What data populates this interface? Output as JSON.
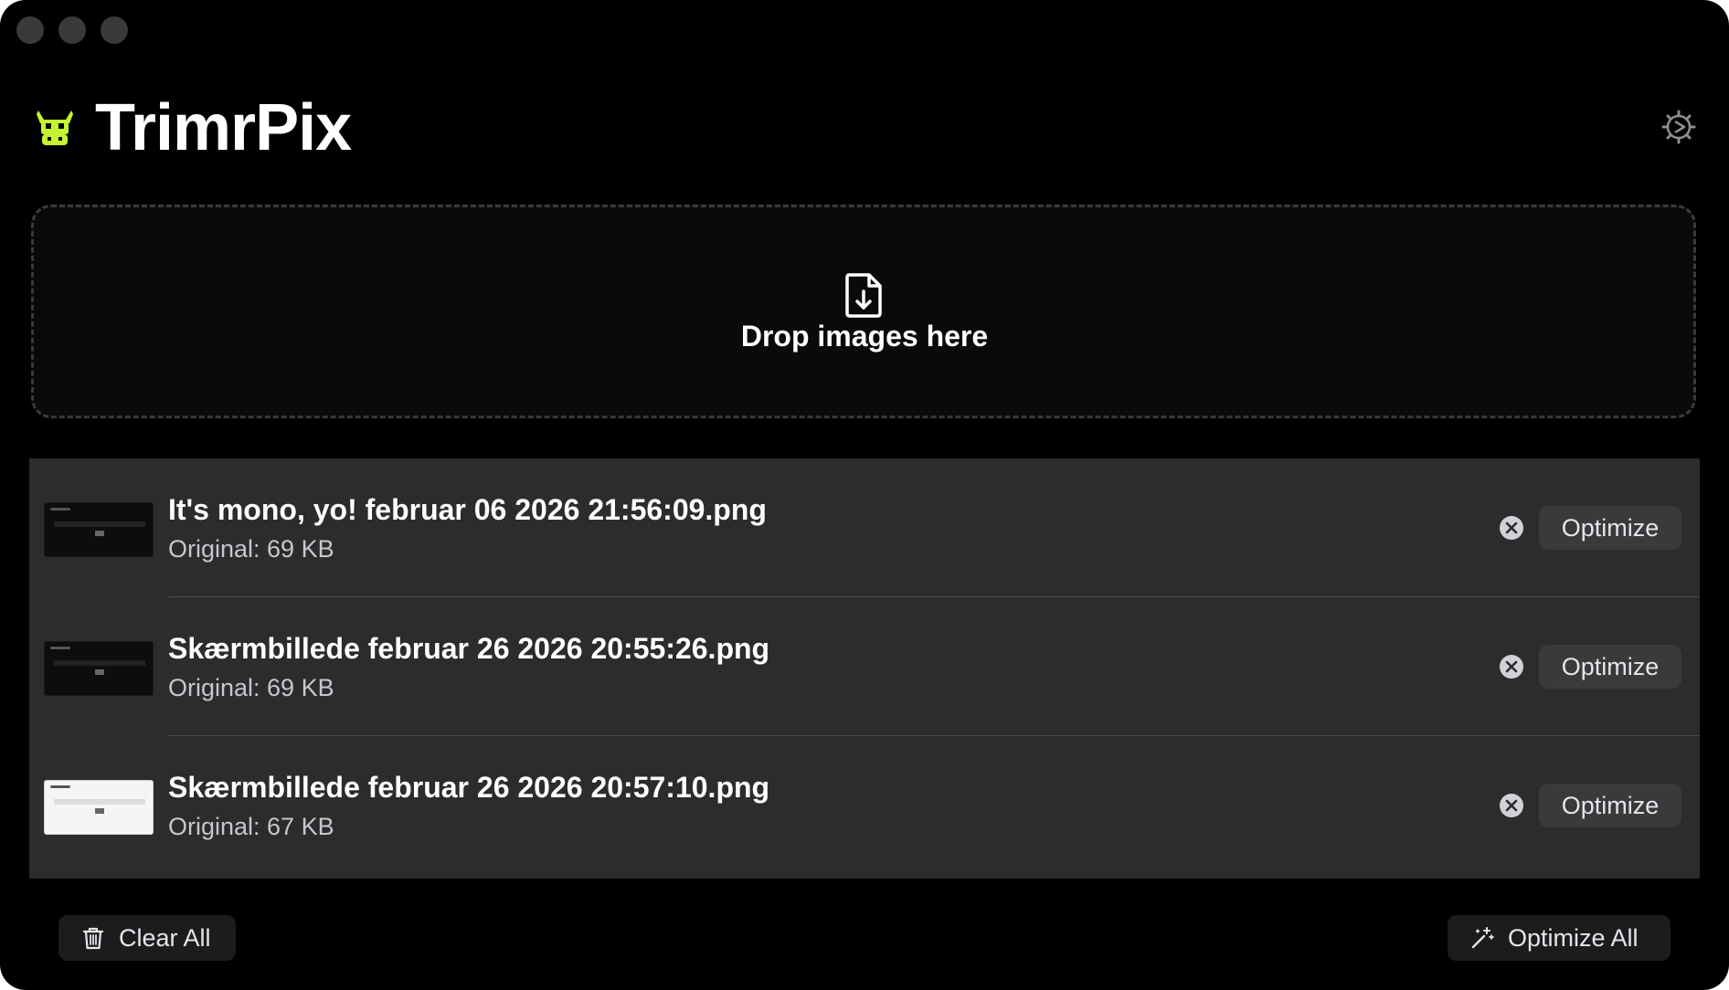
{
  "app": {
    "title": "TrimrPix",
    "logo_icon": "cow-head-icon",
    "accent_color": "#c6f432",
    "settings_icon": "gear-icon"
  },
  "dropzone": {
    "icon": "file-download-icon",
    "label": "Drop images here"
  },
  "files": [
    {
      "name": "It's mono, yo! februar 06 2026 21:56:09.png",
      "size": "Original: 69 KB",
      "thumbnail": "dark",
      "action_label": "Optimize"
    },
    {
      "name": "Skærmbillede februar 26 2026 20:55:26.png",
      "size": "Original: 69 KB",
      "thumbnail": "dark",
      "action_label": "Optimize"
    },
    {
      "name": "Skærmbillede februar 26 2026 20:57:10.png",
      "size": "Original: 67 KB",
      "thumbnail": "light",
      "action_label": "Optimize"
    }
  ],
  "footer": {
    "clear_all_label": "Clear All",
    "clear_all_icon": "trash-icon",
    "optimize_all_label": "Optimize All",
    "optimize_all_icon": "magic-wand-icon"
  }
}
